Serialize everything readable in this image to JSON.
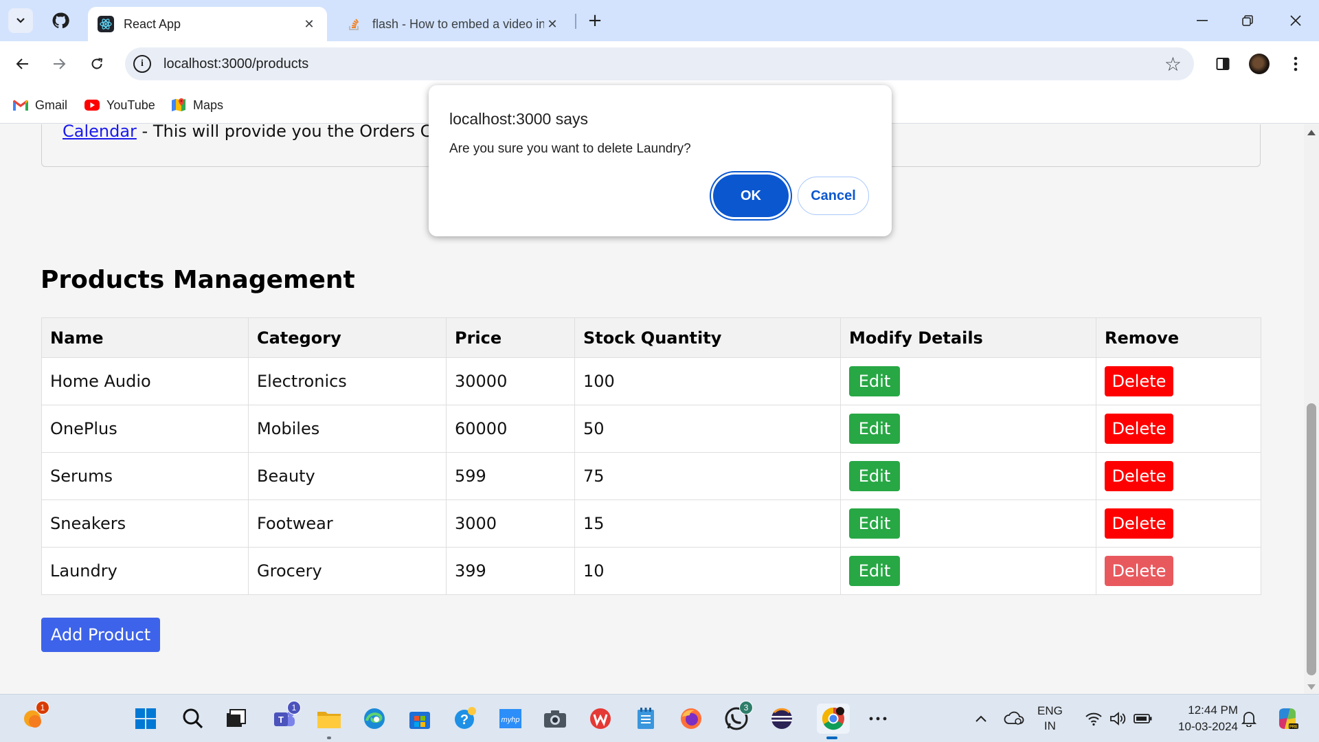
{
  "browser": {
    "tabs": [
      {
        "title": "React App",
        "active": true
      },
      {
        "title": "flash - How to embed a video in",
        "active": false
      }
    ],
    "url": "localhost:3000/products",
    "bookmarks": [
      {
        "label": "Gmail",
        "icon": "gmail-icon"
      },
      {
        "label": "YouTube",
        "icon": "youtube-icon"
      },
      {
        "label": "Maps",
        "icon": "maps-icon"
      }
    ]
  },
  "page": {
    "info_link": "Calendar",
    "info_text": " - This will provide you the Orders Calendar",
    "heading": "Products Management",
    "table": {
      "headers": [
        "Name",
        "Category",
        "Price",
        "Stock Quantity",
        "Modify Details",
        "Remove"
      ],
      "rows": [
        {
          "name": "Home Audio",
          "category": "Electronics",
          "price": "30000",
          "stock": "100"
        },
        {
          "name": "OnePlus",
          "category": "Mobiles",
          "price": "60000",
          "stock": "50"
        },
        {
          "name": "Serums",
          "category": "Beauty",
          "price": "599",
          "stock": "75"
        },
        {
          "name": "Sneakers",
          "category": "Footwear",
          "price": "3000",
          "stock": "15"
        },
        {
          "name": "Laundry",
          "category": "Grocery",
          "price": "399",
          "stock": "10"
        }
      ],
      "edit_label": "Edit",
      "delete_label": "Delete"
    },
    "add_button": "Add Product"
  },
  "dialog": {
    "title": "localhost:3000 says",
    "message": "Are you sure you want to delete Laundry?",
    "ok": "OK",
    "cancel": "Cancel"
  },
  "taskbar": {
    "badges": {
      "weather": "1",
      "teams": "1",
      "whatsapp": "3"
    },
    "lang_top": "ENG",
    "lang_bottom": "IN",
    "time": "12:44 PM",
    "date": "10-03-2024"
  },
  "colors": {
    "edit": "#28a745",
    "delete": "#ff0000",
    "add": "#3d63ea",
    "dialog_primary": "#0b57d0"
  }
}
